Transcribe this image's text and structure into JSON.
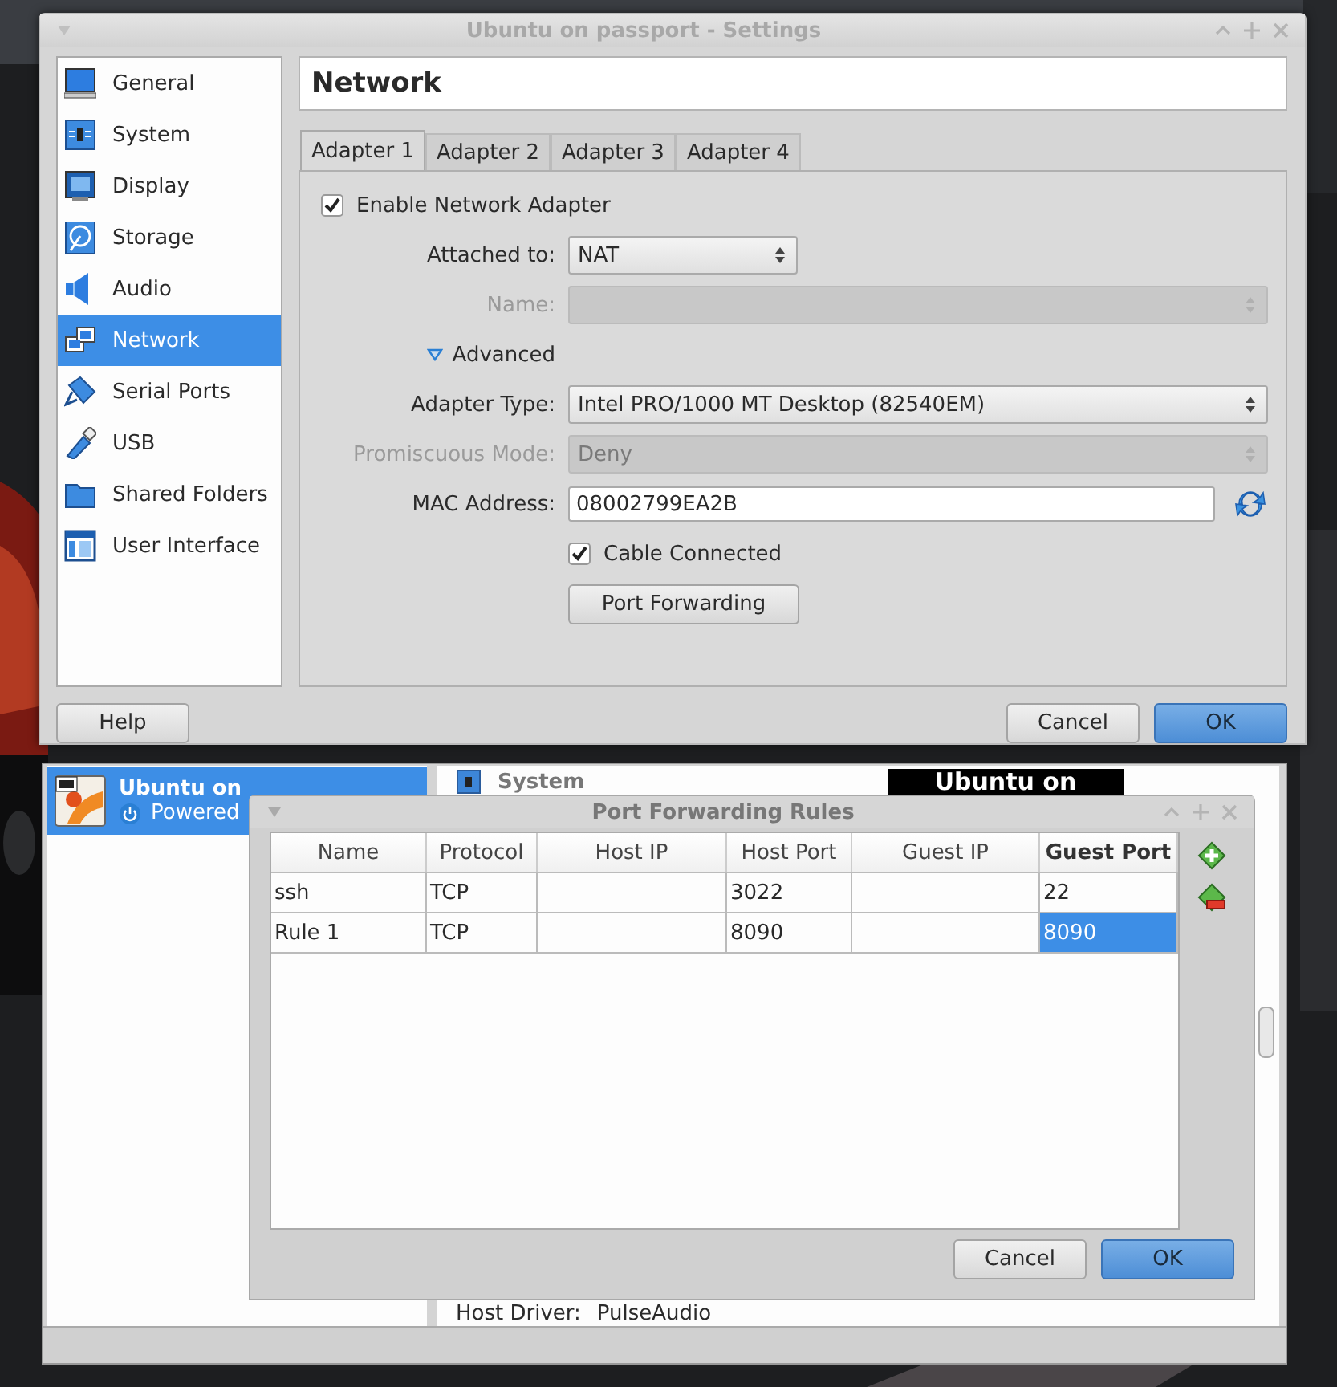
{
  "manager_window": {
    "vm_list": [
      {
        "name": "Ubuntu on",
        "state": "Powered",
        "selected": true
      }
    ],
    "details": {
      "section": "System",
      "preview": "Ubuntu on",
      "host_driver_label": "Host Driver:",
      "host_driver_value": "PulseAudio"
    }
  },
  "settings_window": {
    "title": "Ubuntu on passport - Settings",
    "sidebar": {
      "items": [
        {
          "label": "General",
          "selected": false
        },
        {
          "label": "System",
          "selected": false
        },
        {
          "label": "Display",
          "selected": false
        },
        {
          "label": "Storage",
          "selected": false
        },
        {
          "label": "Audio",
          "selected": false
        },
        {
          "label": "Network",
          "selected": true
        },
        {
          "label": "Serial Ports",
          "selected": false
        },
        {
          "label": "USB",
          "selected": false
        },
        {
          "label": "Shared Folders",
          "selected": false
        },
        {
          "label": "User Interface",
          "selected": false
        }
      ]
    },
    "page_title": "Network",
    "tabs": [
      {
        "label": "Adapter 1",
        "selected": true
      },
      {
        "label": "Adapter 2",
        "selected": false
      },
      {
        "label": "Adapter 3",
        "selected": false
      },
      {
        "label": "Adapter 4",
        "selected": false
      }
    ],
    "form": [
      {
        "kind": "checkbox",
        "label": "Enable Network Adapter",
        "checked": true
      },
      {
        "kind": "select",
        "label": "Attached to:",
        "value": "NAT",
        "disabled": false
      },
      {
        "kind": "select",
        "label": "Name:",
        "disabled": true
      },
      {
        "kind": "expander",
        "label": "Advanced",
        "expanded": true
      },
      {
        "kind": "select",
        "label": "Adapter Type:",
        "value": "Intel PRO/1000 MT Desktop (82540EM)",
        "disabled": false
      },
      {
        "kind": "select",
        "label": "Promiscuous Mode:",
        "value": "Deny",
        "disabled": true
      },
      {
        "kind": "text",
        "label": "MAC Address:",
        "value": "08002799EA2B"
      },
      {
        "kind": "sub-checkbox",
        "label": "Cable Connected",
        "checked": true
      },
      {
        "kind": "button",
        "label": "Port Forwarding"
      }
    ],
    "buttons": [
      {
        "label": "Help",
        "default": false
      },
      {
        "label": "Cancel",
        "default": false
      },
      {
        "label": "OK",
        "default": true
      }
    ]
  },
  "port_forwarding_dialog": {
    "title": "Port Forwarding Rules",
    "columns": [
      {
        "label": "Name",
        "current": false
      },
      {
        "label": "Protocol",
        "current": false
      },
      {
        "label": "Host IP",
        "current": false
      },
      {
        "label": "Host Port",
        "current": false
      },
      {
        "label": "Guest IP",
        "current": false
      },
      {
        "label": "Guest Port",
        "current": true
      }
    ],
    "rows": [
      {
        "cells": [
          {
            "text": "ssh",
            "selected": false
          },
          {
            "text": "TCP",
            "selected": false
          },
          null,
          {
            "text": "3022",
            "selected": false
          },
          null,
          {
            "text": "22",
            "selected": false
          }
        ]
      },
      {
        "cells": [
          {
            "text": "Rule 1",
            "selected": false
          },
          {
            "text": "TCP",
            "selected": false
          },
          null,
          {
            "text": "8090",
            "selected": false
          },
          null,
          {
            "text": "8090",
            "selected": true
          }
        ]
      }
    ],
    "buttons": [
      {
        "label": "Cancel",
        "default": false
      },
      {
        "label": "OK",
        "default": true
      }
    ]
  }
}
